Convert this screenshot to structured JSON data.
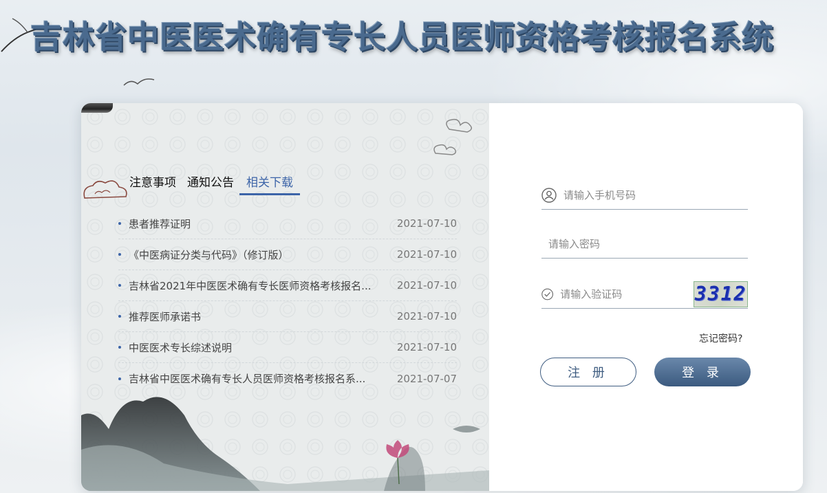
{
  "page": {
    "title": "吉林省中医医术确有专长人员医师资格考核报名系统"
  },
  "tabs": [
    {
      "label": "注意事项",
      "active": false
    },
    {
      "label": "通知公告",
      "active": false
    },
    {
      "label": "相关下载",
      "active": true
    }
  ],
  "downloads": [
    {
      "name": "患者推荐证明",
      "date": "2021-07-10"
    },
    {
      "name": "《中医病证分类与代码》（修订版）",
      "date": "2021-07-10"
    },
    {
      "name": "吉林省2021年中医医术确有专长医师资格考核报名...",
      "date": "2021-07-10"
    },
    {
      "name": "推荐医师承诺书",
      "date": "2021-07-10"
    },
    {
      "name": "中医医术专长综述说明",
      "date": "2021-07-10"
    },
    {
      "name": "吉林省中医医术确有专长人员医师资格考核报名系...",
      "date": "2021-07-07"
    }
  ],
  "login": {
    "phone_placeholder": "请输入手机号码",
    "password_placeholder": "请输入密码",
    "captcha_placeholder": "请输入验证码",
    "captcha_text": "3312",
    "forgot_label": "忘记密码?",
    "register_label": "注 册",
    "login_label": "登 录"
  },
  "colors": {
    "accent": "#3c64a8",
    "login_button": "#4d6d93",
    "title": "#4a6a8e"
  },
  "icons": {
    "phone": "user-icon",
    "password": "key-icon",
    "captcha": "check-circle-icon",
    "keyboard": "keyboard-icon"
  }
}
